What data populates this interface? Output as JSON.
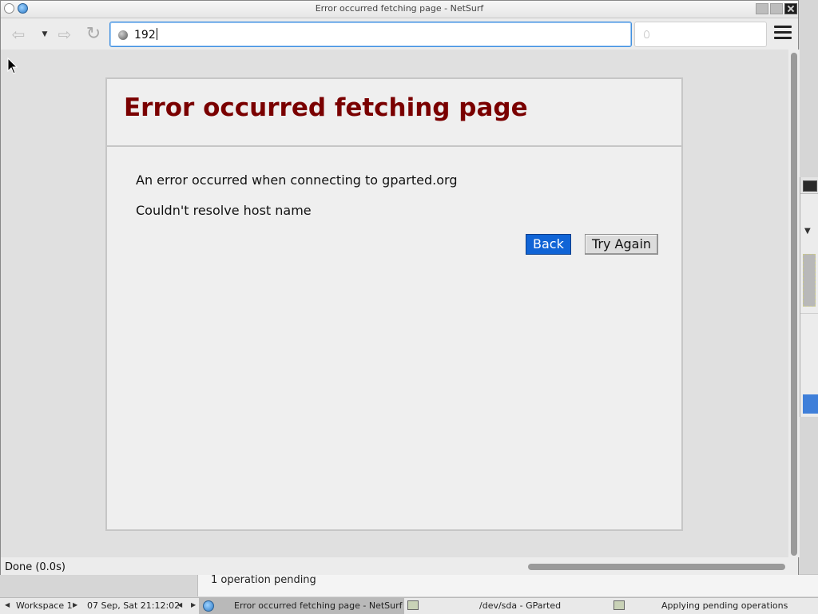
{
  "window": {
    "title": "Error occurred fetching page - NetSurf"
  },
  "toolbar": {
    "url_value": "192",
    "back_icon": "back-arrow-icon",
    "history_icon": "chevron-down-icon",
    "forward_icon": "forward-arrow-icon",
    "reload_icon": "reload-icon",
    "menu_icon": "hamburger-menu-icon"
  },
  "error_page": {
    "title": "Error occurred fetching page",
    "message": "An error occurred when connecting to gparted.org",
    "detail": "Couldn't resolve host name",
    "back_label": "Back",
    "try_again_label": "Try Again"
  },
  "status": {
    "text": "Done (0.0s)"
  },
  "background_window": {
    "pending_text": "1 operation pending"
  },
  "taskbar": {
    "workspace": "Workspace 1",
    "clock": "07 Sep, Sat 21:12:02",
    "tasks": [
      {
        "label": "Error occurred fetching page - NetSurf",
        "active": true
      },
      {
        "label": "/dev/sda - GParted",
        "active": false
      },
      {
        "label": "Applying pending operations",
        "active": false
      }
    ]
  },
  "colors": {
    "error_title": "#7a0000",
    "back_button": "#1064d6",
    "url_focus": "#3f8fe0"
  }
}
